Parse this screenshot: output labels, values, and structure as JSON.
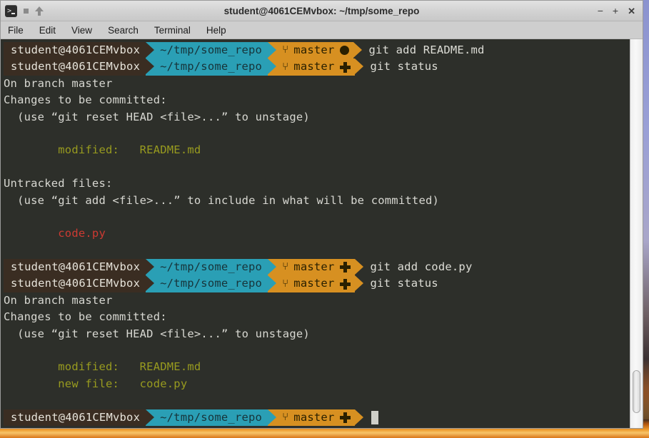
{
  "window": {
    "title": "student@4061CEMvbox: ~/tmp/some_repo",
    "app_icon": "terminal-icon",
    "minimize_label": "−",
    "maximize_label": "+",
    "close_label": "✕"
  },
  "menubar": {
    "items": [
      {
        "label": "File"
      },
      {
        "label": "Edit"
      },
      {
        "label": "View"
      },
      {
        "label": "Search"
      },
      {
        "label": "Terminal"
      },
      {
        "label": "Help"
      }
    ]
  },
  "colors": {
    "terminal_bg": "#2d2f2a",
    "user_segment": "#3a2d22",
    "path_segment": "#2a9fb5",
    "git_segment": "#d79021",
    "text": "#d8d8d2",
    "green": "#989b1f",
    "red": "#cc3a32",
    "cursor": "#cfcfc8"
  },
  "prompt": {
    "user": "student@4061CEMvbox",
    "path": "~/tmp/some_repo",
    "branch_glyph": "⑂",
    "branch": "master"
  },
  "terminal": {
    "lines": [
      {
        "kind": "prompt",
        "git_mark": "dot",
        "command": "git add README.md"
      },
      {
        "kind": "prompt",
        "git_mark": "plus",
        "command": "git status"
      },
      {
        "kind": "text",
        "color": "plain",
        "text": "On branch master"
      },
      {
        "kind": "text",
        "color": "plain",
        "text": "Changes to be committed:"
      },
      {
        "kind": "text",
        "color": "plain",
        "text": "  (use “git reset HEAD <file>...” to unstage)"
      },
      {
        "kind": "text",
        "color": "plain",
        "text": ""
      },
      {
        "kind": "text",
        "color": "green",
        "text": "        modified:   README.md"
      },
      {
        "kind": "text",
        "color": "plain",
        "text": ""
      },
      {
        "kind": "text",
        "color": "plain",
        "text": "Untracked files:"
      },
      {
        "kind": "text",
        "color": "plain",
        "text": "  (use “git add <file>...” to include in what will be committed)"
      },
      {
        "kind": "text",
        "color": "plain",
        "text": ""
      },
      {
        "kind": "text",
        "color": "red",
        "text": "        code.py"
      },
      {
        "kind": "text",
        "color": "plain",
        "text": ""
      },
      {
        "kind": "prompt",
        "git_mark": "plus",
        "command": "git add code.py"
      },
      {
        "kind": "prompt",
        "git_mark": "plus",
        "command": "git status"
      },
      {
        "kind": "text",
        "color": "plain",
        "text": "On branch master"
      },
      {
        "kind": "text",
        "color": "plain",
        "text": "Changes to be committed:"
      },
      {
        "kind": "text",
        "color": "plain",
        "text": "  (use “git reset HEAD <file>...” to unstage)"
      },
      {
        "kind": "text",
        "color": "plain",
        "text": ""
      },
      {
        "kind": "text",
        "color": "green",
        "text": "        modified:   README.md"
      },
      {
        "kind": "text",
        "color": "green",
        "text": "        new file:   code.py"
      },
      {
        "kind": "text",
        "color": "plain",
        "text": ""
      },
      {
        "kind": "prompt",
        "git_mark": "plus",
        "command": "",
        "cursor": true
      }
    ]
  },
  "scrollbar": {
    "name": "vertical-scrollbar"
  }
}
